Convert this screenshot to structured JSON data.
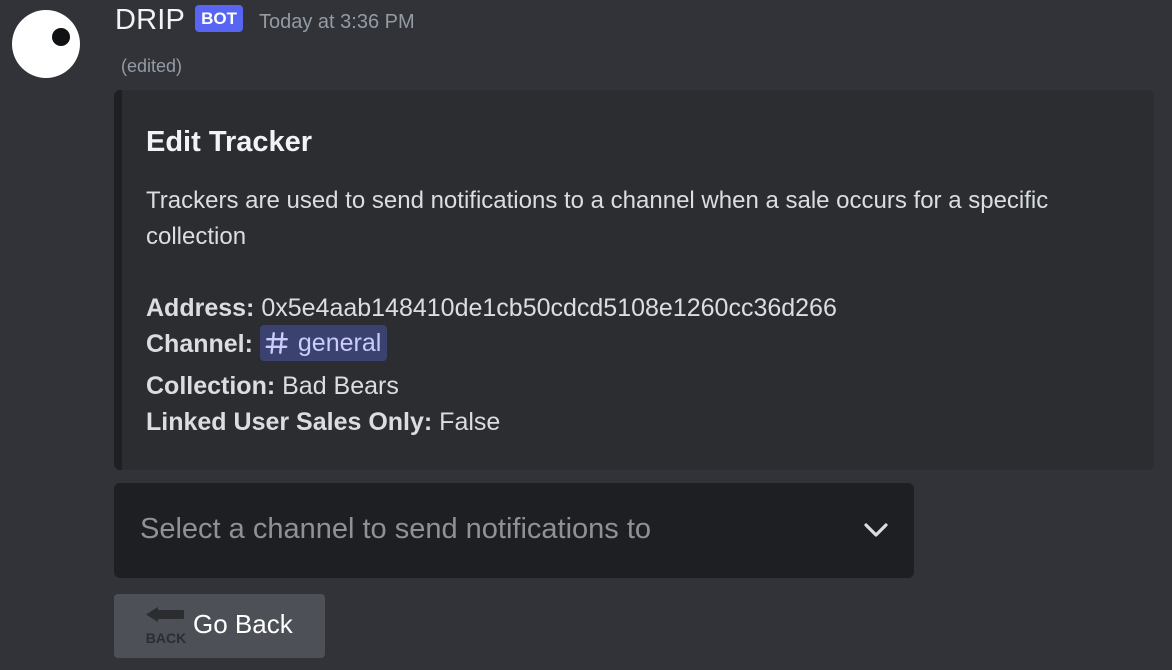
{
  "message": {
    "username": "DRIP",
    "bot_tag": "BOT",
    "timestamp": "Today at 3:36 PM",
    "edited": "(edited)"
  },
  "embed": {
    "title": "Edit Tracker",
    "description": "Trackers are used to send notifications to a channel when a sale occurs for a specific collection",
    "fields": {
      "address_label": "Address:",
      "address_value": "0x5e4aab148410de1cb50cdcd5108e1260cc36d266",
      "channel_label": "Channel:",
      "channel_value": "general",
      "collection_label": "Collection:",
      "collection_value": "Bad Bears",
      "linked_label": "Linked User Sales Only:",
      "linked_value": "False"
    }
  },
  "select": {
    "placeholder": "Select a channel to send notifications to"
  },
  "back_button": {
    "icon_text": "BACK",
    "label": "Go Back"
  },
  "icons": {
    "avatar": "drip-bot-avatar",
    "channel": "hash-icon",
    "dropdown": "chevron-down-icon",
    "back": "back-arrow-icon"
  },
  "colors": {
    "background": "#313338",
    "embed_background": "#2b2d31",
    "bot_tag": "#5865f2",
    "mention_background": "#3c4270",
    "mention_text": "#c9cdfb",
    "select_background": "#1e1f22",
    "button_background": "#4e5058"
  }
}
